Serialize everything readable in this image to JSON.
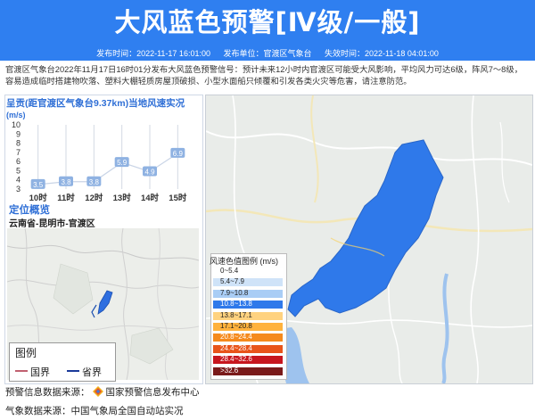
{
  "header": {
    "title": "大风蓝色预警[Ⅳ级/一般]",
    "published": "发布时间：2022-11-17 16:01:00",
    "issuer": "发布单位：官渡区气象台",
    "expires": "失效时间：2022-11-18 04:01:00"
  },
  "description": "官渡区气象台2022年11月17日16时01分发布大风蓝色预警信号：预计未来12小时内官渡区可能受大风影响，平均风力可达6级，阵风7～8级，容易造成临时搭建物吹落、塑料大棚轻质房屋顶破损、小型水面船只倾覆和引发各类火灾等危害，请注意防范。",
  "chart": {
    "title": "呈贡(距官渡区气象台9.37km)当地风速实况",
    "unit": "(m/s)"
  },
  "chart_data": {
    "type": "line",
    "title": "呈贡(距官渡区气象台9.37km)当地风速实况",
    "ylabel": "(m/s)",
    "categories": [
      "10时",
      "11时",
      "12时",
      "13时",
      "14时",
      "15时"
    ],
    "values": [
      3.5,
      3.8,
      3.8,
      5.9,
      4.9,
      6.9
    ],
    "yticks": [
      "3",
      "4",
      "5",
      "6",
      "7",
      "8",
      "9",
      "10"
    ],
    "ylim": [
      3,
      10
    ],
    "grid": false
  },
  "location": {
    "heading": "定位概览",
    "region": "云南省-昆明市-官渡区"
  },
  "mini_legend": {
    "title": "图例",
    "national": "国界",
    "provincial": "省界"
  },
  "legend": {
    "title": "风速色值图例 (m/s)",
    "items": [
      {
        "label": "0~5.4",
        "color": "#ffffff"
      },
      {
        "label": "5.4~7.9",
        "color": "#cfe3f8"
      },
      {
        "label": "7.9~10.8",
        "color": "#a9cdf5"
      },
      {
        "label": "10.8~13.8",
        "color": "#2f79ea"
      },
      {
        "label": "13.8~17.1",
        "color": "#ffd27f"
      },
      {
        "label": "17.1~20.8",
        "color": "#ffb23d"
      },
      {
        "label": "20.8~24.4",
        "color": "#f58a1d"
      },
      {
        "label": "24.4~28.4",
        "color": "#e8541a"
      },
      {
        "label": "28.4~32.6",
        "color": "#c7161e"
      },
      {
        "label": ">32.6",
        "color": "#7a1a1a"
      }
    ]
  },
  "footer": {
    "warning_source": "预警信息数据来源：",
    "warning_source_name": "国家预警信息发布中心",
    "weather_source": "气象数据来源：中国气象局全国自动站实况"
  }
}
